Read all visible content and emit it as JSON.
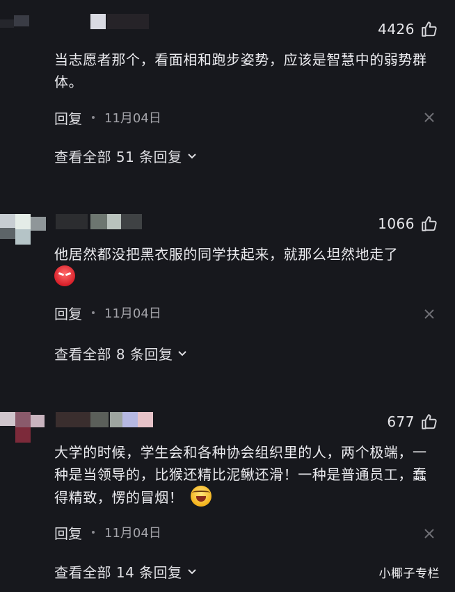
{
  "comments": [
    {
      "likes": "4426",
      "text": "当志愿者那个，看面相和跑步姿势，应该是智慧中的弱势群体。",
      "reply_label": "回复",
      "date": "11月04日",
      "view_replies": "查看全部 51 条回复"
    },
    {
      "likes": "1066",
      "text": "他居然都没把黑衣服的同学扶起来，就那么坦然地走了",
      "reply_label": "回复",
      "date": "11月04日",
      "view_replies": "查看全部 8 条回复"
    },
    {
      "likes": "677",
      "text": "大学的时候，学生会和各种协会组织里的人，两个极端，一种是当领导的，比猴还精比泥鳅还滑！一种是普通员工，蠢得精致，愣的冒烟！",
      "reply_label": "回复",
      "date": "11月04日",
      "view_replies": "查看全部 14 条回复"
    }
  ],
  "watermark": "小椰子专栏",
  "icons": {
    "like": "thumbs-up-icon",
    "close": "close-icon",
    "expand": "chevron-down-icon",
    "emoji_1": "angry-face-emoji",
    "emoji_2": "laughing-face-emoji"
  },
  "colors": {
    "background": "#17181d",
    "text": "#ebebef",
    "muted": "#a4a4aa"
  }
}
